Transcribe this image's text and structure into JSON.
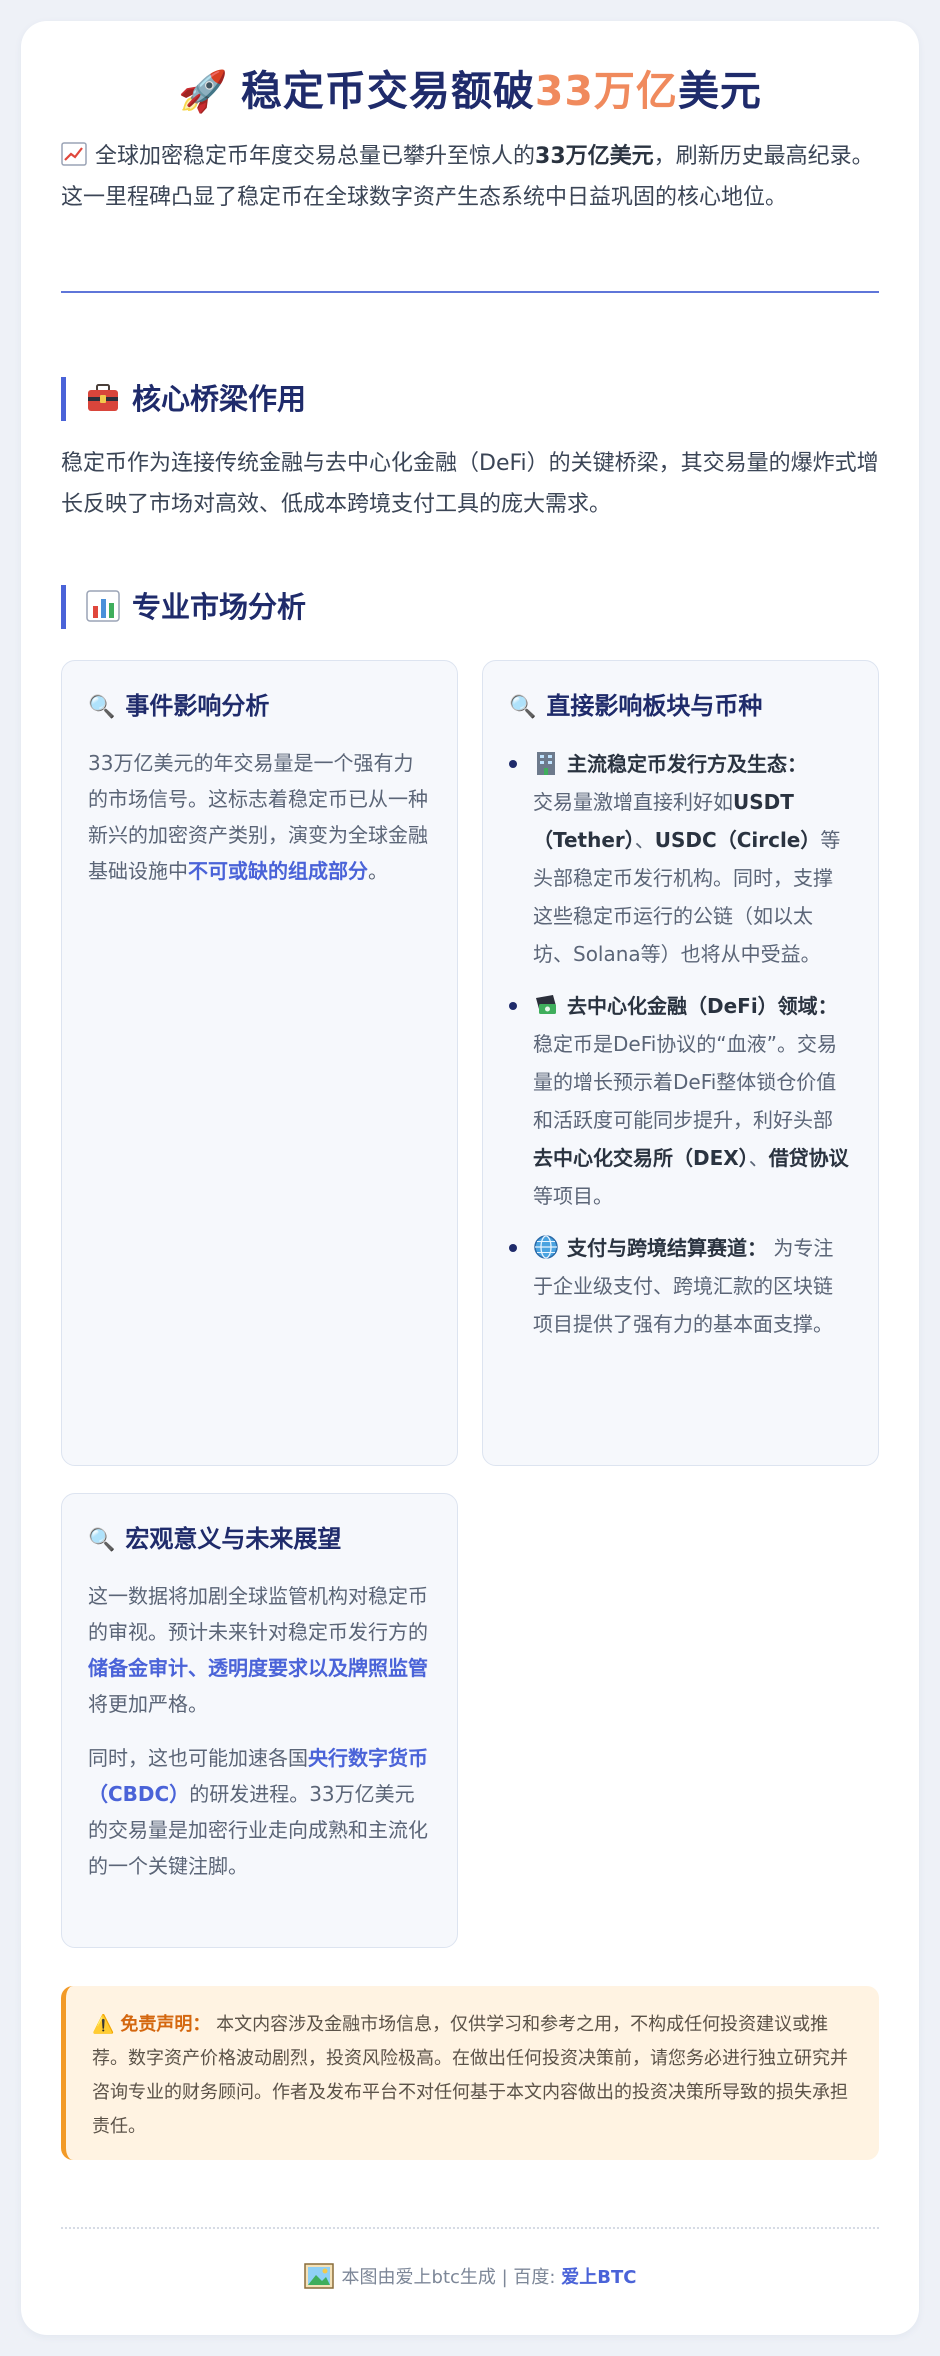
{
  "header": {
    "title_prefix": "稳定币交易额破",
    "title_accent": "33万亿",
    "title_suffix": "美元",
    "intro_part1": "全球加密稳定币年度交易总量已攀升至惊人的",
    "intro_bold": "33万亿美元",
    "intro_part2": "，刷新历史最高纪录。这一里程碑凸显了稳定币在全球数字资产生态系统中日益巩固的核心地位。"
  },
  "sections": {
    "bridge": {
      "title": "核心桥梁作用",
      "text": "稳定币作为连接传统金融与去中心化金融（DeFi）的关键桥梁，其交易量的爆炸式增长反映了市场对高效、低成本跨境支付工具的庞大需求。"
    },
    "analysis": {
      "title": "专业市场分析"
    }
  },
  "box_event": {
    "title": "事件影响分析",
    "text_part1": "33万亿美元的年交易量是一个强有力的市场信号。这标志着稳定币已从一种新兴的加密资产类别，演变为全球金融基础设施中",
    "text_highlight": "不可或缺的组成部分",
    "text_part2": "。"
  },
  "box_sectors": {
    "title": "直接影响板块与币种",
    "items": [
      {
        "icon": "office-building-icon",
        "label": "主流稳定币发行方及生态：",
        "t1": "交易量激增直接利好如",
        "b1": "USDT（Tether）",
        "t2": "、",
        "b2": "USDC（Circle）",
        "t3": "等头部稳定币发行机构。同时，支撑这些稳定币运行的公链（如以太坊、Solana等）也将从中受益。"
      },
      {
        "icon": "money-exchange-icon",
        "label": "去中心化金融（DeFi）领域：",
        "t1": " 稳定币是DeFi协议的“血液”。交易量的增长预示着DeFi整体锁仓价值和活跃度可能同步提升，利好头部",
        "b1": "去中心化交易所（DEX）",
        "t2": "、",
        "b2": "借贷协议",
        "t3": "等项目。"
      },
      {
        "icon": "globe-icon",
        "label": "支付与跨境结算赛道：",
        "t1": " 为专注于企业级支付、跨境汇款的区块链项目提供了强有力的基本面支撑。"
      }
    ]
  },
  "box_macro": {
    "title": "宏观意义与未来展望",
    "p1_part1": "这一数据将加剧全球监管机构对稳定币的审视。预计未来针对稳定币发行方的",
    "p1_highlight": "储备金审计、透明度要求以及牌照监管",
    "p1_part2": "将更加严格。",
    "p2_part1": "同时，这也可能加速各国",
    "p2_highlight": "央行数字货币（CBDC）",
    "p2_part2": "的研发进程。33万亿美元的交易量是加密行业走向成熟和主流化的一个关键注脚。"
  },
  "disclaimer": {
    "label": "免责声明：",
    "text": " 本文内容涉及金融市场信息，仅供学习和参考之用，不构成任何投资建议或推荐。数字资产价格波动剧烈，投资风险极高。在做出任何投资决策前，请您务必进行独立研究并咨询专业的财务顾问。作者及发布平台不对任何基于本文内容做出的投资决策所导致的损失承担责任。"
  },
  "footer": {
    "text": "本图由爱上btc生成 | 百度: ",
    "brand": "爱上BTC"
  },
  "colors": {
    "title": "#1f2b6b",
    "accent": "#f08a5d",
    "highlight": "#4a63d8",
    "warning": "#d4670f"
  }
}
